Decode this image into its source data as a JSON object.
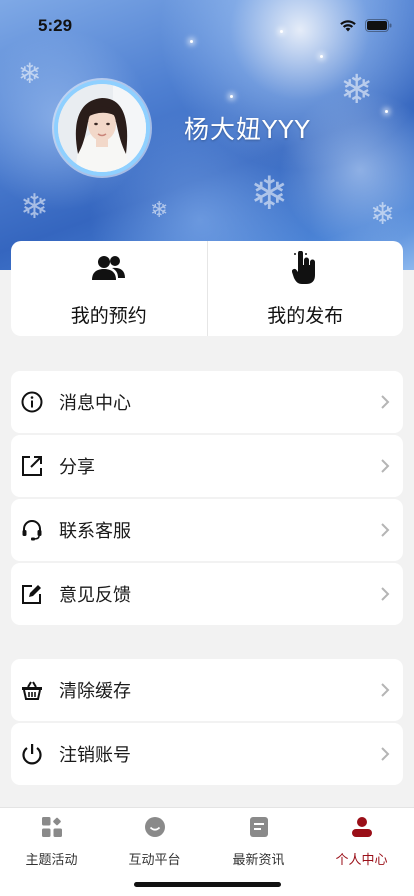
{
  "status_bar": {
    "time": "5:29"
  },
  "profile": {
    "username": "杨大妞YYY"
  },
  "quick_actions": [
    {
      "label": "我的预约",
      "icon": "users-icon"
    },
    {
      "label": "我的发布",
      "icon": "tap-hand-icon"
    }
  ],
  "menu_groups": [
    [
      {
        "label": "消息中心",
        "icon": "info-icon"
      },
      {
        "label": "分享",
        "icon": "share-icon"
      },
      {
        "label": "联系客服",
        "icon": "headset-icon"
      },
      {
        "label": "意见反馈",
        "icon": "edit-icon"
      }
    ],
    [
      {
        "label": "清除缓存",
        "icon": "basket-icon"
      },
      {
        "label": "注销账号",
        "icon": "power-icon"
      }
    ]
  ],
  "tabbar": {
    "tabs": [
      {
        "label": "主题活动",
        "icon": "grid-icon",
        "active": false
      },
      {
        "label": "互动平台",
        "icon": "smile-icon",
        "active": false
      },
      {
        "label": "最新资讯",
        "icon": "document-icon",
        "active": false
      },
      {
        "label": "个人中心",
        "icon": "person-icon",
        "active": true
      }
    ]
  },
  "colors": {
    "accent": "#9a0f18",
    "avatar_ring": "#8fd0ff",
    "background": "#f2f2f2"
  }
}
